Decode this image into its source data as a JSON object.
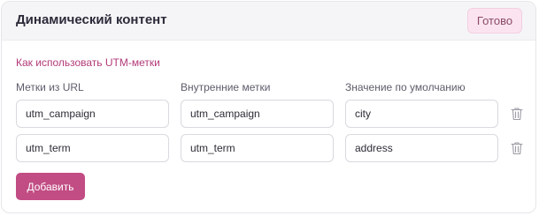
{
  "header": {
    "title": "Динамический контент",
    "done_label": "Готово"
  },
  "help_link": "Как использовать UTM-метки",
  "columns": {
    "url_tags": "Метки из URL",
    "internal_tags": "Внутренние метки",
    "default_value": "Значение по умолчанию"
  },
  "rows": [
    {
      "url_tag": "utm_campaign",
      "internal_tag": "utm_campaign",
      "default": "city"
    },
    {
      "url_tag": "utm_term",
      "internal_tag": "utm_term",
      "default": "address"
    }
  ],
  "add_label": "Добавить",
  "icons": {
    "delete": "trash-icon"
  },
  "colors": {
    "accent": "#c24c84",
    "link": "#b23a78",
    "done_bg": "#fbe4ef",
    "header_bg": "#f5f5f7"
  }
}
